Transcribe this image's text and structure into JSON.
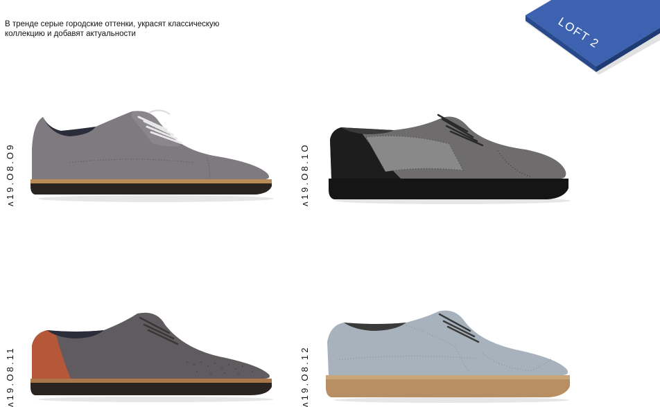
{
  "intro": {
    "line1": "В тренде серые городские оттенки, украсят классическую",
    "line2": "коллекцию и добавят актуальности"
  },
  "badge": {
    "label": "LOFT 2",
    "colors": {
      "top": "#3d62b0",
      "side": "#284a8c",
      "text": "#ffffff"
    }
  },
  "products": [
    {
      "sku": "ʌ19.O8.O9",
      "image": "grey-suede-derby-cap-toe",
      "colors": {
        "upper": "#7f7a80",
        "sole": "#2a2320",
        "welt": "#b88a55"
      }
    },
    {
      "sku": "ʌ19.O8.1O",
      "image": "grey-suede-mesh-brogue",
      "colors": {
        "upper": "#6e6c6c",
        "heel": "#1d1d1d",
        "sole": "#151515"
      }
    },
    {
      "sku": "ʌ19.O8.11",
      "image": "grey-suede-perforated-derby",
      "colors": {
        "upper": "#5f5b5e",
        "heel": "#b6573a",
        "sole": "#2a2320",
        "welt": "#a9774a"
      }
    },
    {
      "sku": "ʌ19.O8.12",
      "image": "light-grey-suede-wingtip-brogue",
      "colors": {
        "upper": "#a7b2bd",
        "sole": "#b88f62",
        "welt": "#c9a57a"
      }
    }
  ]
}
